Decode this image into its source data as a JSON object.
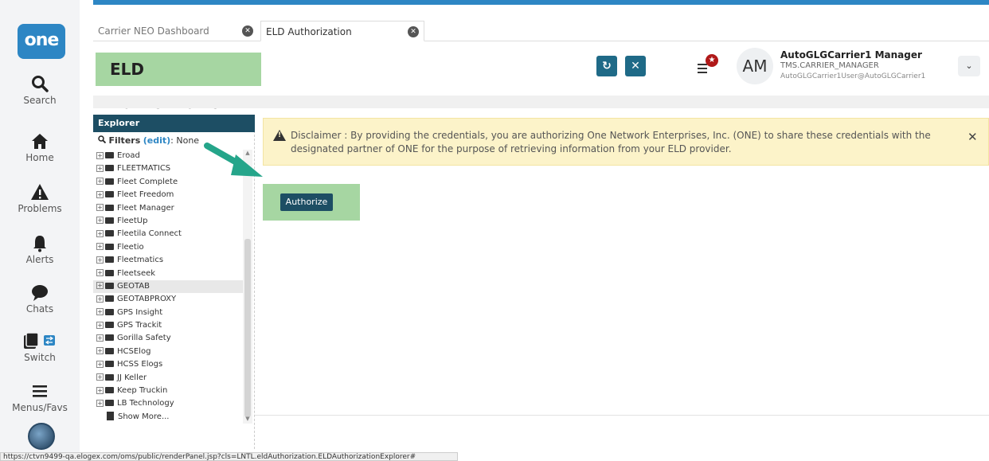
{
  "logo": "one",
  "rail": [
    {
      "label": "Search"
    },
    {
      "label": "Home"
    },
    {
      "label": "Problems"
    },
    {
      "label": "Alerts"
    },
    {
      "label": "Chats"
    },
    {
      "label": "Switch"
    },
    {
      "label": "Menus/Favs"
    }
  ],
  "tabs": [
    {
      "label": "Carrier NEO Dashboard"
    },
    {
      "label": "ELD Authorization"
    }
  ],
  "header": {
    "title": "ELD Authorization",
    "refresh_icon": "↻",
    "close_icon": "✕"
  },
  "user": {
    "initials": "AM",
    "name": "AutoGLGCarrier1 Manager",
    "role": "TMS.CARRIER_MANAGER",
    "email": "AutoGLGCarrier1User@AutoGLGCarrier1"
  },
  "explorer": {
    "title": "Explorer",
    "filters_label": "Filters",
    "filters_edit": "(edit)",
    "filters_value": "None",
    "items": [
      "Eroad",
      "FLEETMATICS",
      "Fleet Complete",
      "Fleet Freedom",
      "Fleet Manager",
      "FleetUp",
      "Fleetila Connect",
      "Fleetio",
      "Fleetmatics",
      "Fleetseek",
      "GEOTAB",
      "GEOTABPROXY",
      "GPS Insight",
      "GPS Trackit",
      "Gorilla Safety",
      "HCSElog",
      "HCSS Elogs",
      "JJ Keller",
      "Keep Truckin",
      "LB Technology"
    ],
    "show_more": "Show More..."
  },
  "disclaimer": {
    "text": "Disclaimer : By providing the credentials, you are authorizing One Network Enterprises, Inc. (ONE) to share these credentials with the designated partner of ONE for the purpose of retrieving information from your ELD provider.",
    "close": "✕"
  },
  "authorize_label": "Authorize",
  "status_url": "https://ctvn9499-qa.elogex.com/oms/public/renderPanel.jsp?cls=LNTL.eldAuthorization.ELDAuthorizationExplorer#"
}
